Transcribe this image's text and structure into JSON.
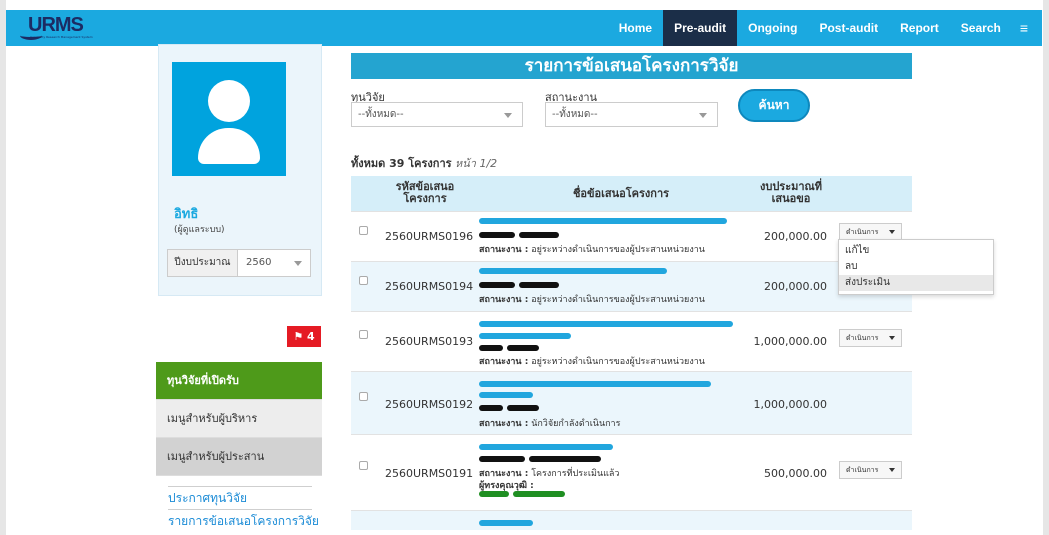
{
  "navbar": {
    "logo": "URMS",
    "logo_sub": "University Research Management System",
    "items": [
      {
        "label": "Home"
      },
      {
        "label": "Pre-audit",
        "active": true
      },
      {
        "label": "Ongoing"
      },
      {
        "label": "Post-audit"
      },
      {
        "label": "Report"
      },
      {
        "label": "Search"
      }
    ],
    "menu_icon": "hamburger-icon",
    "menu_glyph": "≡"
  },
  "profile": {
    "avatar_icon": "user-avatar-icon",
    "name": "อิทธิ",
    "role": "(ผู้ดูแลระบบ)",
    "fiscal_year_label": "ปีงบประมาณ",
    "fiscal_year_value": "2560"
  },
  "notification_badge": {
    "glyph": "⚑",
    "count": "4"
  },
  "sidebar": {
    "items": [
      {
        "label": "ทุนวิจัยที่เปิดรับ",
        "style": "green"
      },
      {
        "label": "เมนูสำหรับผู้บริหาร",
        "style": "light"
      },
      {
        "label": "เมนูสำหรับผู้ประสาน",
        "style": "dark"
      }
    ],
    "links": [
      {
        "label": "ประกาศทุนวิจัย"
      },
      {
        "label": "รายการข้อเสนอโครงการวิจัย"
      }
    ]
  },
  "main": {
    "title": "รายการข้อเสนอโครงการวิจัย",
    "filters": {
      "fund_label": "ทุนวิจัย",
      "fund_value": "--ทั้งหมด--",
      "agency_label": "สถานะงาน",
      "agency_value": "--ทั้งหมด--"
    },
    "search_button": "ค้นหา",
    "count_prefix": "ทั้งหมด 39 โครงการ",
    "page_info": "หน้า 1/2",
    "table": {
      "headers": [
        "รหัสข้อเสนอโครงการ",
        "ชื่อข้อเสนอโครงการ",
        "งบประมาณที่เสนอขอ"
      ],
      "header_code_line1": "รหัสข้อเสนอ",
      "header_code_line2": "โครงการ",
      "header_name": "ชื่อข้อเสนอโครงการ",
      "header_budget_line1": "งบประมาณที่",
      "header_budget_line2": "เสนอขอ",
      "status_prefix": "สถานะงาน :",
      "expert_label": "ผู้ทรงคุณวุฒิ :",
      "action_label": "ดำเนินการ",
      "rows": [
        {
          "code": "2560URMS0196",
          "status": "อยู่ระหว่างดำเนินการของผู้ประสานหน่วยงาน",
          "amount": "200,000.00",
          "action": true
        },
        {
          "code": "2560URMS0194",
          "status": "อยู่ระหว่างดำเนินการของผู้ประสานหน่วยงาน",
          "amount": "200,000.00",
          "action": false
        },
        {
          "code": "2560URMS0193",
          "status": "อยู่ระหว่างดำเนินการของผู้ประสานหน่วยงาน",
          "amount": "1,000,000.00",
          "action": true
        },
        {
          "code": "2560URMS0192",
          "status": "นักวิจัยกำลังดำเนินการ",
          "amount": "1,000,000.00",
          "action": false
        },
        {
          "code": "2560URMS0191",
          "status": "โครงการที่ประเมินแล้ว",
          "amount": "500,000.00",
          "action": true
        }
      ]
    },
    "action_menu": {
      "items": [
        {
          "label": "แก้ไข"
        },
        {
          "label": "ลบ"
        },
        {
          "label": "ส่งประเมิน",
          "hover": true
        }
      ]
    }
  }
}
